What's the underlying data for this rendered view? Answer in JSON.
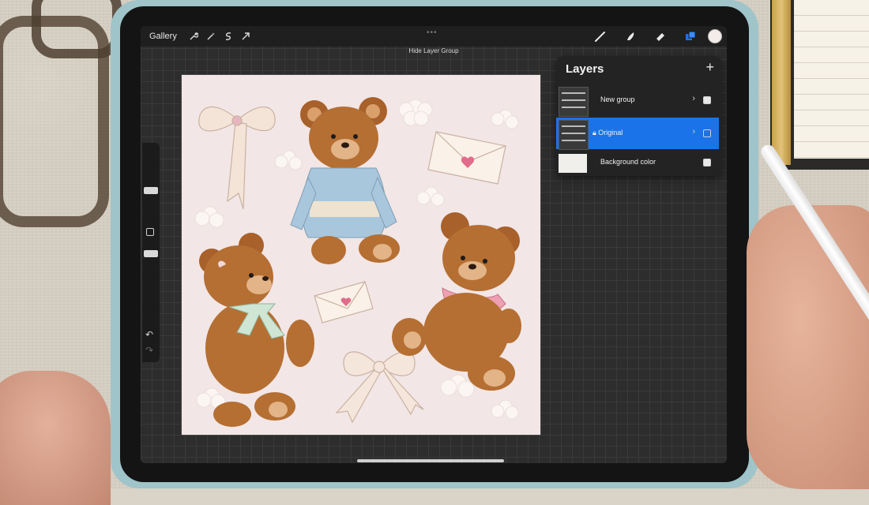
{
  "toolbar": {
    "gallery_label": "Gallery",
    "left_icons": [
      "wrench-icon",
      "magic-wand-icon",
      "selection-icon",
      "transform-arrow-icon"
    ],
    "right_icons": [
      "brush-icon",
      "smudge-icon",
      "eraser-icon",
      "layers-icon"
    ],
    "hint": "Hide Layer Group",
    "active_color": "#f3ece8"
  },
  "layers_panel": {
    "title": "Layers",
    "add_label": "+",
    "layers": [
      {
        "name": "New group",
        "type": "group",
        "visible": true
      },
      {
        "name": "Original",
        "type": "layer",
        "locked": true,
        "selected": true,
        "visible": false
      },
      {
        "name": "Background color",
        "type": "background",
        "visible": true
      }
    ]
  },
  "sidebar": {
    "undo_label": "↶",
    "redo_label": "↷"
  },
  "colors": {
    "accent": "#1a73e8",
    "canvas": "#f2e6e6",
    "case": "#9fc4c9"
  }
}
